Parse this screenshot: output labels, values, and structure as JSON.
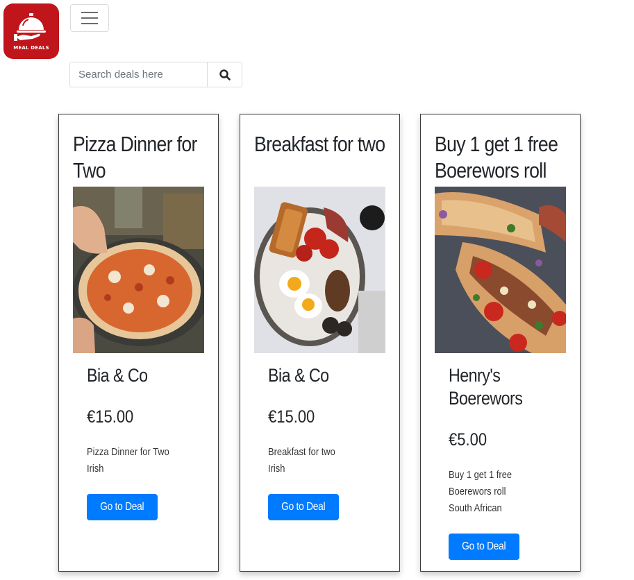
{
  "header": {
    "logo_text": "MEAL DEALS",
    "menu_icon": "hamburger-menu-icon"
  },
  "search": {
    "placeholder": "Search deals here",
    "button_icon": "search-icon"
  },
  "colors": {
    "brand": "#c0161b",
    "button": "#007bff"
  },
  "deals": [
    {
      "title": "Pizza Dinner for Two",
      "image": "pizza-photo",
      "restaurant": "Bia & Co",
      "price": "€15.00",
      "description": "Pizza Dinner for Two",
      "cuisine": "Irish",
      "button_label": "Go to Deal"
    },
    {
      "title": "Breakfast for two",
      "image": "breakfast-photo",
      "restaurant": "Bia & Co",
      "price": "€15.00",
      "description": "Breakfast for two",
      "cuisine": "Irish",
      "button_label": "Go to Deal"
    },
    {
      "title": "Buy 1 get 1 free Boerewors roll",
      "image": "boerewors-roll-photo",
      "restaurant": "Henry's Boerewors",
      "price": "€5.00",
      "description": "Buy 1 get 1 free Boerewors roll",
      "cuisine": "South African",
      "button_label": "Go to Deal"
    }
  ]
}
